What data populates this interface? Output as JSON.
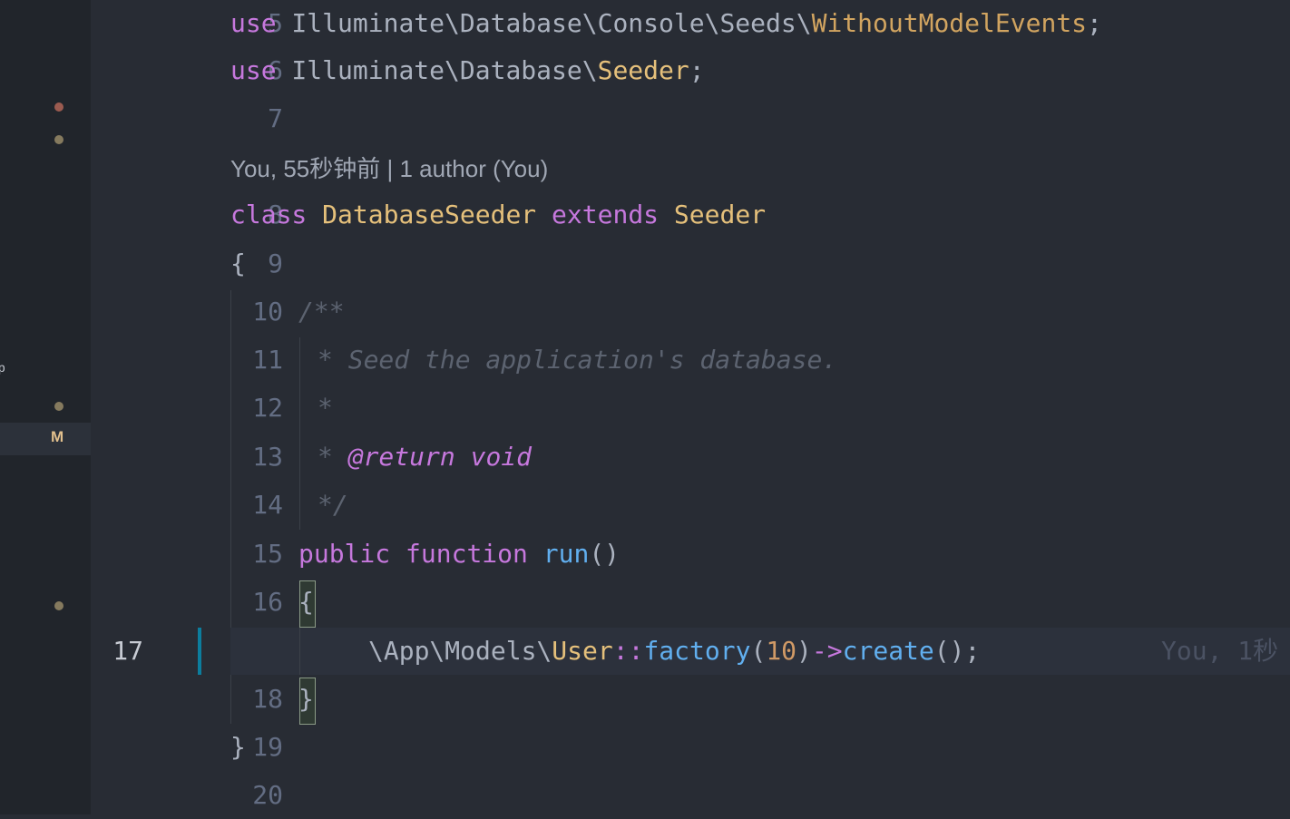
{
  "sidebar": {
    "modified_badge": "M",
    "edge_glyph": "ᵖ"
  },
  "codelens": {
    "text": "You, 55秒钟前 | 1 author (You)"
  },
  "blame": {
    "inline_text": "You, 1秒"
  },
  "lines": [
    {
      "n": "5"
    },
    {
      "n": "6"
    },
    {
      "n": "7"
    },
    {
      "n": "8"
    },
    {
      "n": "9"
    },
    {
      "n": "10"
    },
    {
      "n": "11"
    },
    {
      "n": "12"
    },
    {
      "n": "13"
    },
    {
      "n": "14"
    },
    {
      "n": "15"
    },
    {
      "n": "16"
    },
    {
      "n": "17"
    },
    {
      "n": "18"
    },
    {
      "n": "19"
    },
    {
      "n": "20"
    }
  ],
  "code": {
    "l5": [
      "use",
      " Illuminate\\Database\\Console\\Seeds\\",
      "WithoutModelEvents",
      ";"
    ],
    "l6": [
      "use",
      " Illuminate\\Database\\",
      "Seeder",
      ";"
    ],
    "l8": [
      "class",
      " ",
      "DatabaseSeeder",
      " ",
      "extends",
      " ",
      "Seeder"
    ],
    "l9": [
      "{"
    ],
    "l10": [
      "/**"
    ],
    "l11": [
      "* Seed the application's database."
    ],
    "l12": [
      "*"
    ],
    "l13": [
      "* ",
      "@return",
      " ",
      "void"
    ],
    "l14": [
      "*/"
    ],
    "l15": [
      "public",
      " ",
      "function",
      " ",
      "run",
      "()"
    ],
    "l16": [
      "{"
    ],
    "l17": [
      "\\App\\Models\\",
      "User",
      "::",
      "factory",
      "(",
      "10",
      ")",
      "->",
      "create",
      "();"
    ],
    "l18": [
      "}"
    ],
    "l19": [
      "}"
    ]
  },
  "colors": {
    "background": "#282c34",
    "keyword": "#c678dd",
    "class": "#e5c07b",
    "function": "#61afef",
    "number": "#d19a66",
    "comment": "#5c6370",
    "modified": "#e2c08d"
  }
}
